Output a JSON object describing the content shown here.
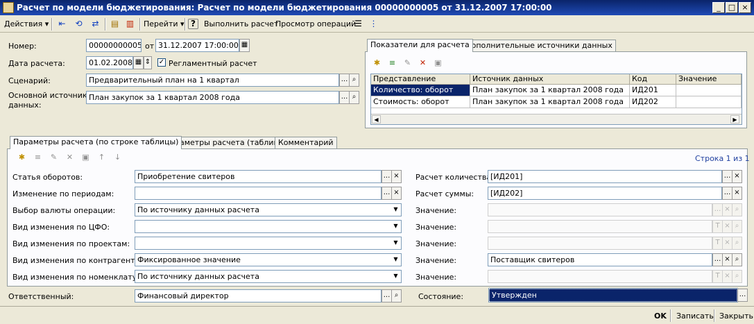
{
  "window": {
    "title": "Расчет по модели бюджетирования: Расчет по модели бюджетирования 00000000005 от 31.12.2007 17:00:00",
    "minimize": "_",
    "maximize": "□",
    "close": "×"
  },
  "toolbar": {
    "actions": "Действия ▾",
    "goto": "Перейти ▾",
    "help": "?",
    "run": "Выполнить расчет",
    "view_ops": "Просмотр операций"
  },
  "header": {
    "number_label": "Номер:",
    "number_value": "00000000005",
    "from_label": "от",
    "date_value": "31.12.2007 17:00:00",
    "calc_date_label": "Дата расчета:",
    "calc_date_value": "01.02.2008",
    "regulated_label": "Регламентный расчет",
    "scenario_label": "Сценарий:",
    "scenario_value": "Предварительный план на 1 квартал",
    "source_label_1": "Основной источник",
    "source_label_2": "данных:",
    "source_value": "План закупок за 1 квартал 2008 года"
  },
  "indicators": {
    "tabs": [
      "Показатели для расчета",
      "Дополнительные источники данных"
    ],
    "columns": [
      "Представление",
      "Источник данных",
      "Код",
      "Значение"
    ],
    "rows": [
      [
        "Количество: оборот",
        "План закупок за 1 квартал 2008 года",
        "ИД201",
        ""
      ],
      [
        "Стоимость: оборот",
        "План закупок за 1 квартал 2008 года",
        "ИД202",
        ""
      ]
    ]
  },
  "params": {
    "tabs": [
      "Параметры расчета (по строке таблицы)",
      "Параметры расчета (таблица)",
      "Комментарий"
    ],
    "row_counter": "Строка 1 из 1",
    "left_fields": [
      {
        "label": "Статья оборотов:",
        "value": "Приобретение свитеров"
      },
      {
        "label": "Изменение по периодам:",
        "value": ""
      },
      {
        "label": "Выбор валюты операции:",
        "value": "По источнику данных расчета"
      },
      {
        "label": "Вид изменения по ЦФО:",
        "value": ""
      },
      {
        "label": "Вид изменения по проектам:",
        "value": ""
      },
      {
        "label": "Вид изменения по контрагентам:",
        "value": "Фиксированное значение"
      },
      {
        "label": "Вид изменения по номенклатуре:",
        "value": "По источнику данных расчета"
      }
    ],
    "right_fields": [
      {
        "label": "Расчет количества:",
        "value": "[ИД201]"
      },
      {
        "label": "Расчет суммы:",
        "value": "[ИД202]"
      },
      {
        "label": "Значение:",
        "value": ""
      },
      {
        "label": "Значение:",
        "value": ""
      },
      {
        "label": "Значение:",
        "value": ""
      },
      {
        "label": "Значение:",
        "value": "Поставщик свитеров"
      },
      {
        "label": "Значение:",
        "value": ""
      }
    ]
  },
  "footer_fields": {
    "responsible_label": "Ответственный:",
    "responsible_value": "Финансовый директор",
    "state_label": "Состояние:",
    "state_value": "Утвержден"
  },
  "buttons": {
    "ok": "OK",
    "save": "Записать",
    "close": "Закрыть"
  },
  "glyphs": {
    "ellipsis": "...",
    "clear": "×",
    "search": "⌕",
    "dropdown": "▼",
    "calendar": "▦",
    "spin": "⇕",
    "text": "T",
    "check": "✓"
  },
  "colors": {
    "title_bar": "#0a246a",
    "selection": "#0a246a",
    "window_bg": "#ece9d8",
    "field_border": "#7f9db9"
  }
}
